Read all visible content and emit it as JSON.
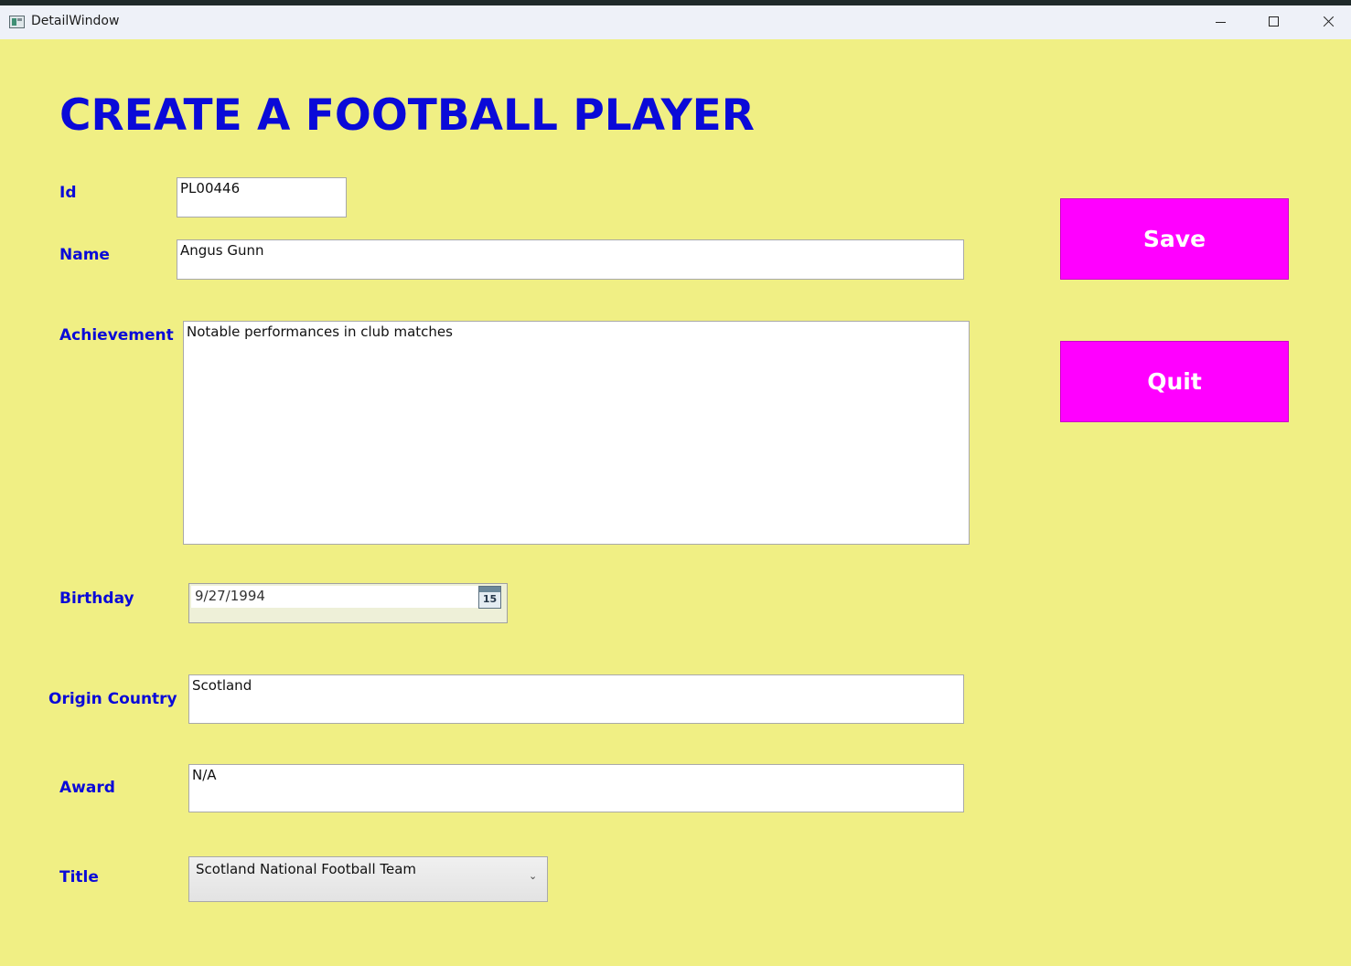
{
  "window": {
    "title": "DetailWindow",
    "controls": [
      "minimize",
      "maximize",
      "close"
    ]
  },
  "form": {
    "heading": "CREATE A FOOTBALL PLAYER",
    "fields": {
      "id": {
        "label": "Id",
        "value": "PL00446"
      },
      "name": {
        "label": "Name",
        "value": "Angus Gunn"
      },
      "achievement": {
        "label": "Achievement",
        "value": "Notable performances in club matches"
      },
      "birthday": {
        "label": "Birthday",
        "value": "9/27/1994",
        "calendar_icon_text": "15"
      },
      "origin_country": {
        "label": "Origin Country",
        "value": "Scotland"
      },
      "award": {
        "label": "Award",
        "value": "N/A"
      },
      "title": {
        "label": "Title",
        "value": "Scotland National Football Team",
        "chevron": "⌄"
      }
    }
  },
  "buttons": {
    "save": "Save",
    "quit": "Quit"
  },
  "colors": {
    "background": "#f0ef84",
    "heading_text": "#0a0ad8",
    "button_bg": "#ff00ff",
    "button_text": "#ffffff"
  },
  "icons": {
    "app": "window-app-icon",
    "calendar": "calendar-icon",
    "minimize": "minimize-icon",
    "maximize": "maximize-icon",
    "close": "close-icon",
    "dropdown": "chevron-down-icon"
  }
}
